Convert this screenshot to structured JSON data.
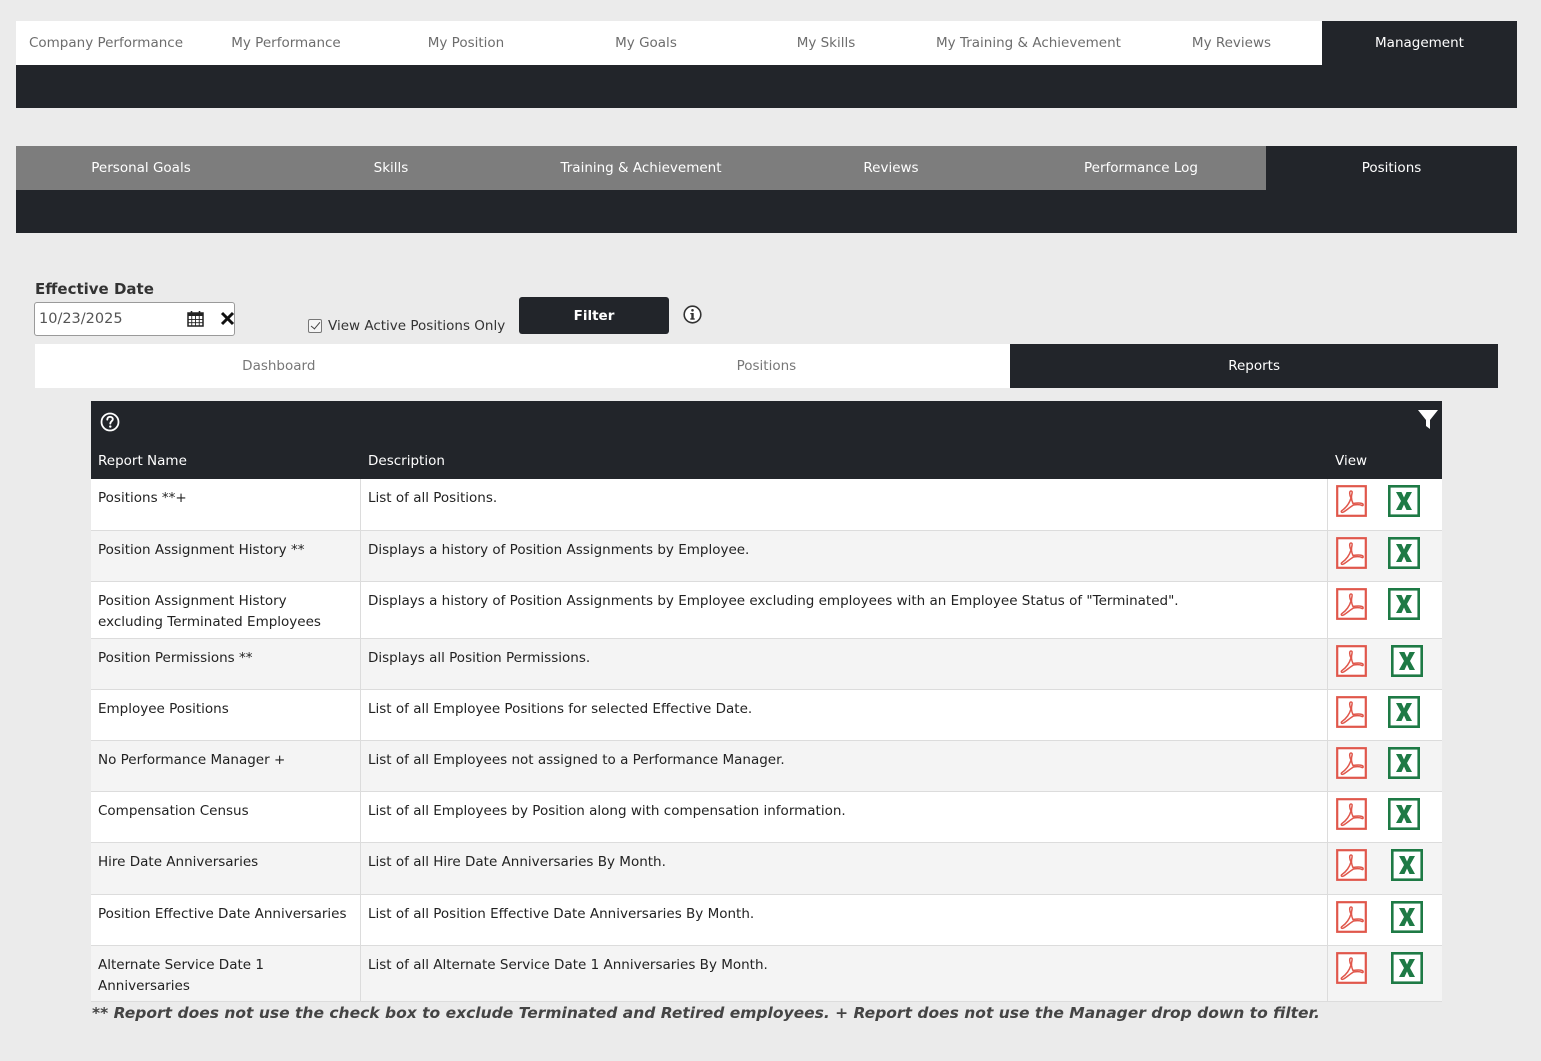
{
  "top_nav": {
    "tabs": [
      {
        "label": "Company Performance",
        "active": false
      },
      {
        "label": "My Performance",
        "active": false
      },
      {
        "label": "My Position",
        "active": false
      },
      {
        "label": "My Goals",
        "active": false
      },
      {
        "label": "My Skills",
        "active": false
      },
      {
        "label": "My Training & Achievement",
        "active": false
      },
      {
        "label": "My Reviews",
        "active": false
      },
      {
        "label": "Management",
        "active": true
      }
    ]
  },
  "sub_nav": {
    "tabs": [
      {
        "label": "Personal Goals",
        "active": false
      },
      {
        "label": "Skills",
        "active": false
      },
      {
        "label": "Training & Achievement",
        "active": false
      },
      {
        "label": "Reviews",
        "active": false
      },
      {
        "label": "Performance Log",
        "active": false
      },
      {
        "label": "Positions",
        "active": true
      }
    ]
  },
  "filters": {
    "effective_date_label": "Effective Date",
    "effective_date_value": "10/23/2025",
    "active_only_label": "View Active Positions Only",
    "active_only_checked": true,
    "filter_button": "Filter"
  },
  "view_tabs": [
    {
      "label": "Dashboard",
      "active": false
    },
    {
      "label": "Positions",
      "active": false
    },
    {
      "label": "Reports",
      "active": true
    }
  ],
  "table": {
    "headers": {
      "name": "Report Name",
      "description": "Description",
      "view": "View"
    },
    "rows": [
      {
        "name": "Positions **+",
        "description": "List of all Positions."
      },
      {
        "name": "Position Assignment History **",
        "description": "Displays a history of Position Assignments by Employee."
      },
      {
        "name": "Position Assignment History excluding Terminated Employees",
        "description": "Displays a history of Position Assignments by Employee excluding employees with an Employee Status of \"Terminated\"."
      },
      {
        "name": "Position Permissions **",
        "description": "Displays all Position Permissions."
      },
      {
        "name": "Employee Positions",
        "description": "List of all Employee Positions for selected Effective Date."
      },
      {
        "name": "No Performance Manager +",
        "description": "List of all Employees not assigned to a Performance Manager."
      },
      {
        "name": "Compensation Census",
        "description": "List of all Employees by Position along with compensation information."
      },
      {
        "name": "Hire Date Anniversaries",
        "description": "List of all Hire Date Anniversaries By Month."
      },
      {
        "name": "Position Effective Date Anniversaries",
        "description": "List of all Position Effective Date Anniversaries By Month."
      },
      {
        "name": "Alternate Service Date 1 Anniversaries",
        "description": "List of all Alternate Service Date 1 Anniversaries By Month."
      }
    ]
  },
  "footnote": "** Report does not use the check box to exclude Terminated and Retired employees. + Report does not use the Manager drop down to filter.",
  "colors": {
    "dark": "#22252a",
    "subnav_gray": "#7d7d7d",
    "pdf_red": "#e0574b",
    "excel_green": "#1e7a45"
  }
}
